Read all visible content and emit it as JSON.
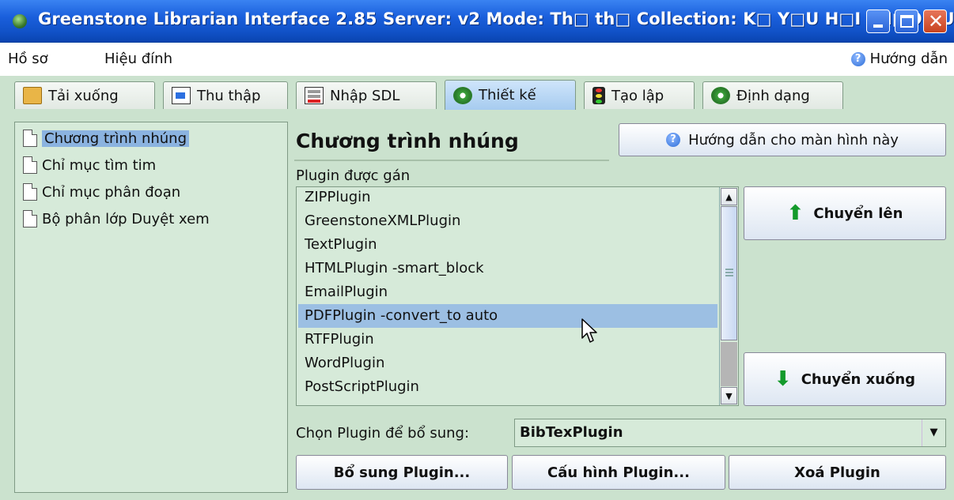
{
  "window": {
    "title": "Greenstone Librarian Interface 2.85  Server: v2  Mode: Th□ th□  Collection: K□ Y□U H□I TH□O VU..."
  },
  "menu": {
    "items": [
      {
        "label": "Hồ sơ"
      },
      {
        "label": "Hiệu đính"
      }
    ],
    "help_label": "Hướng dẫn"
  },
  "tabs": [
    {
      "label": "Tải xuống",
      "icon": "download-folder-icon"
    },
    {
      "label": "Thu thập",
      "icon": "gather-document-icon"
    },
    {
      "label": "Nhập SDL",
      "icon": "metadata-edit-icon"
    },
    {
      "label": "Thiết kế",
      "icon": "gear-icon",
      "active": true
    },
    {
      "label": "Tạo lập",
      "icon": "traffic-light-icon"
    },
    {
      "label": "Định dạng",
      "icon": "gear-icon"
    }
  ],
  "sidebar": {
    "items": [
      {
        "label": "Chương trình nhúng",
        "selected": true
      },
      {
        "label": "Chỉ mục tìm tim"
      },
      {
        "label": "Chỉ mục phân đoạn"
      },
      {
        "label": "Bộ phân lớp Duyệt xem"
      }
    ]
  },
  "main": {
    "heading": "Chương trình nhúng",
    "help_button": "Hướng dẫn cho màn hình này",
    "assigned_label": "Plugin được gán",
    "plugins": [
      {
        "label": "ZIPPlugin"
      },
      {
        "label": "GreenstoneXMLPlugin"
      },
      {
        "label": "TextPlugin"
      },
      {
        "label": "HTMLPlugin -smart_block"
      },
      {
        "label": "EmailPlugin"
      },
      {
        "label": "PDFPlugin -convert_to auto",
        "selected": true
      },
      {
        "label": "RTFPlugin"
      },
      {
        "label": "WordPlugin"
      },
      {
        "label": "PostScriptPlugin"
      }
    ],
    "move_up": "Chuyển lên",
    "move_down": "Chuyển xuống",
    "select_label": "Chọn Plugin để bổ sung:",
    "select_value": "BibTexPlugin",
    "add_button": "Bổ sung Plugin...",
    "configure_button": "Cấu hình Plugin...",
    "remove_button": "Xoá Plugin"
  },
  "colors": {
    "panel_bg": "#cbe2ce",
    "selection": "#9cbfe3",
    "titlebar": "#1a5fdc",
    "arrow": "#139a2b"
  }
}
